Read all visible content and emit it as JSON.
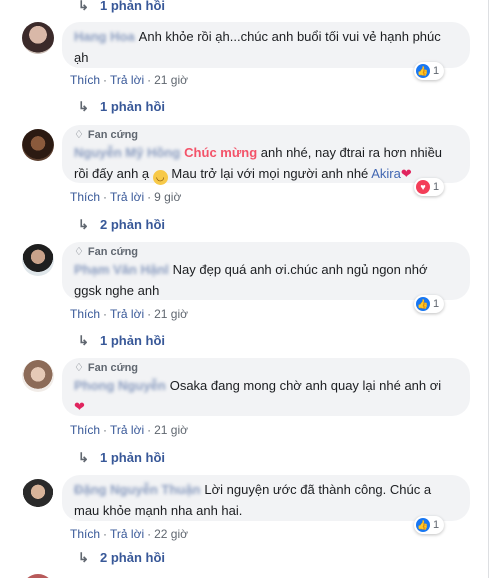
{
  "replies": {
    "r0": "1 phản hồi",
    "r1": "1 phản hồi",
    "r2": "2 phản hồi",
    "r3": "1 phản hồi",
    "r4": "1 phản hồi",
    "r5": "2 phản hồi"
  },
  "actions": {
    "like": "Thích",
    "reply": "Trả lời",
    "sep": "·"
  },
  "fan_badge": "Fan cứng",
  "comments": [
    {
      "name": "Hang Hoa",
      "text": "Anh khỏe rồi ạh...chúc anh buổi tối vui vẻ hạnh phúc",
      "text2": "ạh",
      "time": "21 giờ",
      "react_count": "1"
    },
    {
      "name": "Nguyễn Mỹ Hồng",
      "highlight": "Chúc mừng",
      "text": "anh nhé, nay đtrai ra hơn nhiều",
      "text2a": "rồi đấy anh ạ",
      "text2b": "Mau trở lại với mọi người anh nhé",
      "tag": "Akira",
      "time": "9 giờ",
      "react_count": "1"
    },
    {
      "name": "Phạm Văn Hậnl",
      "text": "Nay đẹp quá anh ơi.chúc anh ngủ ngon nhớ",
      "text2": "ggsk nghe anh",
      "time": "21 giờ",
      "react_count": "1"
    },
    {
      "name": "Phong Nguyễn",
      "text": "Osaka đang mong chờ anh quay lại nhé anh ơi",
      "time": "21 giờ"
    },
    {
      "name": "Đặng Nguyễn Thuận",
      "text": "Lời nguyện ước đã thành công. Chúc a",
      "text2": "mau khỏe mạnh nha anh hai.",
      "time": "22 giờ",
      "react_count": "1"
    }
  ],
  "colors": {
    "link": "#385898",
    "highlight": "#f35369",
    "bubble": "#f2f3f5",
    "like": "#1877f2",
    "heart": "#e0245e"
  }
}
